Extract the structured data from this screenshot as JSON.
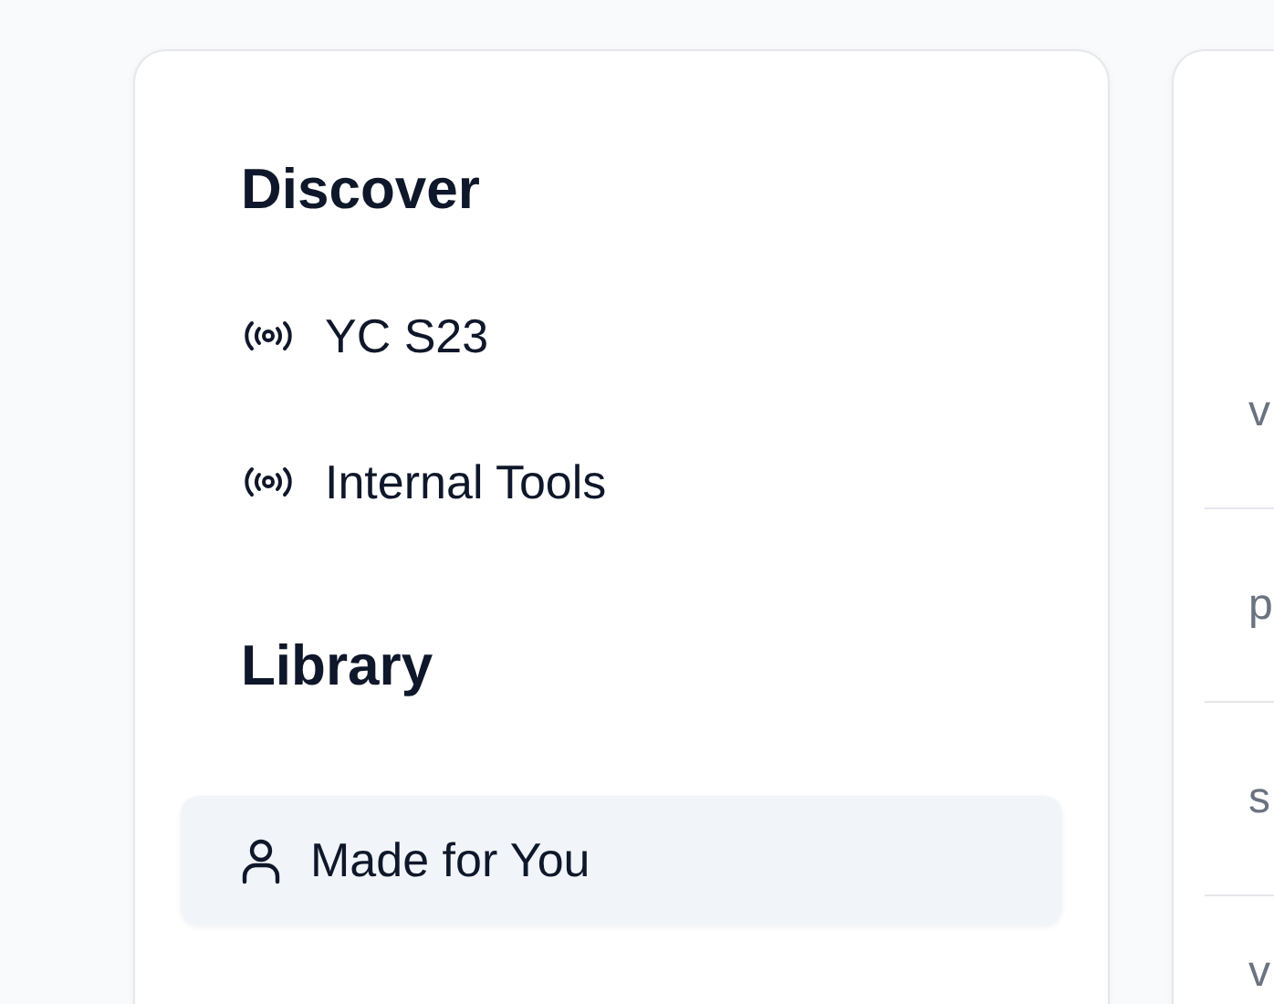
{
  "sidebar": {
    "sections": [
      {
        "title": "Discover",
        "items": [
          {
            "label": "YC S23",
            "kind": "broadcast",
            "selected": false
          },
          {
            "label": "Internal Tools",
            "kind": "broadcast",
            "selected": false
          }
        ]
      },
      {
        "title": "Library",
        "items": [
          {
            "label": "Made for You",
            "kind": "user",
            "selected": true
          }
        ]
      }
    ]
  },
  "list": {
    "rows": [
      "v",
      "p",
      "s",
      "v"
    ]
  }
}
